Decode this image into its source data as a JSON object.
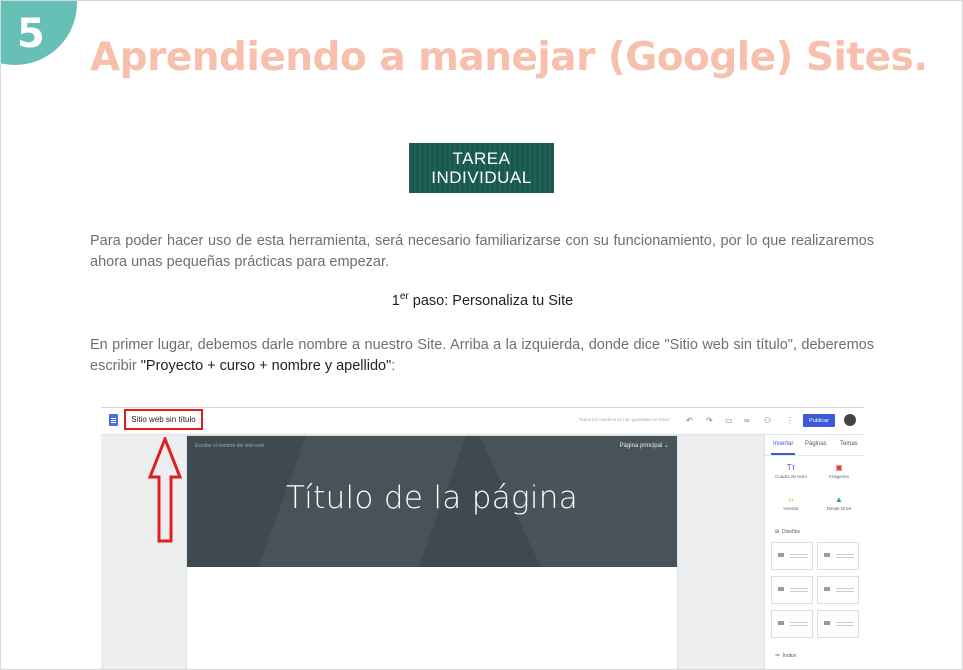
{
  "step_number": "5",
  "title": "Aprendiendo a manejar (Google) Sites.",
  "task_label": {
    "line1": "TAREA",
    "line2": "INDIVIDUAL"
  },
  "paragraph1": "Para poder hacer uso de esta herramienta, será necesario familiarizarse con su funcionamiento, por lo que realizaremos ahora unas pequeñas prácticas para empezar.",
  "step_line": {
    "number": "1",
    "sup": "er",
    "text": " paso: Personaliza tu Site"
  },
  "paragraph2": {
    "part1": "En primer lugar, debemos darle nombre a nuestro Site. Arriba a la izquierda, donde dice ",
    "quote1": "\"Sitio web sin título\"",
    "part2": ", deberemos escribir ",
    "quote2": "\"Proyecto + curso + nombre y apellido\"",
    "part3": ":"
  },
  "screenshot": {
    "site_title": "Sitio web sin título",
    "saved_note": "Todos los cambios se han guardado en Drive",
    "publish_label": "Publicar",
    "hero_subtitle": "Escribe el nombre del sitio web",
    "hero_nav": "Página principal ⌄",
    "hero_title": "Título de la página",
    "panel_tabs": [
      "Insertar",
      "Páginas",
      "Temas"
    ],
    "panel_items": [
      {
        "glyph": "Tт",
        "label": "Cuadro de texto"
      },
      {
        "glyph": "▣",
        "label": "Imágenes"
      },
      {
        "glyph": "‹›",
        "label": "Insertar"
      },
      {
        "glyph": "▲",
        "label": "Desde Drive"
      }
    ],
    "section_layouts": "Diseños",
    "section_index": "Índice"
  },
  "colors": {
    "accent": "#67c0b6",
    "title": "#f6c0ad",
    "task_box": "#17594f",
    "highlight": "#e02020",
    "publish": "#3b5bdb"
  }
}
